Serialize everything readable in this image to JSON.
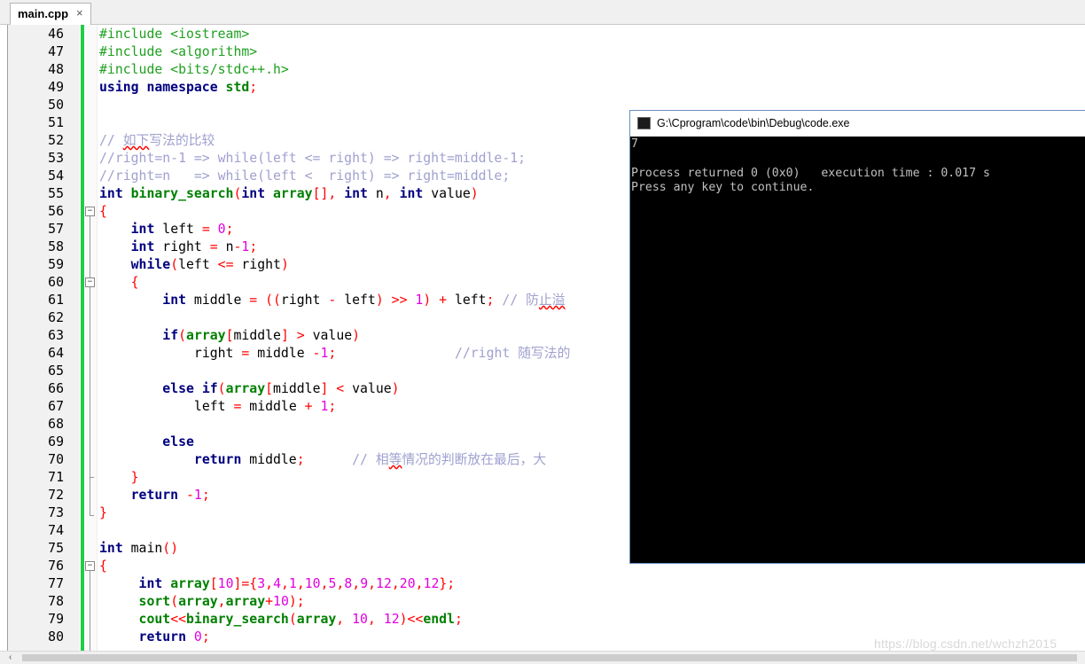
{
  "tab": {
    "label": "main.cpp",
    "close": "×"
  },
  "editor": {
    "lines": [
      {
        "n": "46",
        "tokens": [
          {
            "t": "#include <iostream>",
            "c": "pp"
          }
        ]
      },
      {
        "n": "47",
        "tokens": [
          {
            "t": "#include <algorithm>",
            "c": "pp"
          }
        ]
      },
      {
        "n": "48",
        "tokens": [
          {
            "t": "#include <bits/stdc++.h>",
            "c": "pp"
          }
        ]
      },
      {
        "n": "49",
        "tokens": [
          {
            "t": "using namespace ",
            "c": "kw"
          },
          {
            "t": "std",
            "c": "fn"
          },
          {
            "t": ";",
            "c": "op"
          }
        ]
      },
      {
        "n": "50",
        "tokens": []
      },
      {
        "n": "51",
        "tokens": []
      },
      {
        "n": "52",
        "tokens": [
          {
            "t": "// ",
            "c": "cm"
          },
          {
            "t": "如下",
            "c": "cm squig"
          },
          {
            "t": "写法的比较",
            "c": "cm"
          }
        ]
      },
      {
        "n": "53",
        "tokens": [
          {
            "t": "//right=n-1 => while(left <= right) => right=middle-1;",
            "c": "cm"
          }
        ]
      },
      {
        "n": "54",
        "tokens": [
          {
            "t": "//right=n   => while(left <  right) => right=middle;",
            "c": "cm"
          }
        ]
      },
      {
        "n": "55",
        "tokens": [
          {
            "t": "int ",
            "c": "kw"
          },
          {
            "t": "binary_search",
            "c": "fn"
          },
          {
            "t": "(",
            "c": "op"
          },
          {
            "t": "int ",
            "c": "kw"
          },
          {
            "t": "array",
            "c": "fn"
          },
          {
            "t": "[], ",
            "c": "op"
          },
          {
            "t": "int ",
            "c": "kw"
          },
          {
            "t": "n",
            "c": ""
          },
          {
            "t": ", ",
            "c": "op"
          },
          {
            "t": "int ",
            "c": "kw"
          },
          {
            "t": "value",
            "c": ""
          },
          {
            "t": ")",
            "c": "op"
          }
        ]
      },
      {
        "n": "56",
        "tokens": [
          {
            "t": "{",
            "c": "op"
          }
        ]
      },
      {
        "n": "57",
        "tokens": [
          {
            "t": "    ",
            "c": ""
          },
          {
            "t": "int ",
            "c": "kw"
          },
          {
            "t": "left ",
            "c": ""
          },
          {
            "t": "= ",
            "c": "op"
          },
          {
            "t": "0",
            "c": "num"
          },
          {
            "t": ";",
            "c": "op"
          }
        ]
      },
      {
        "n": "58",
        "tokens": [
          {
            "t": "    ",
            "c": ""
          },
          {
            "t": "int ",
            "c": "kw"
          },
          {
            "t": "right ",
            "c": ""
          },
          {
            "t": "= ",
            "c": "op"
          },
          {
            "t": "n",
            "c": ""
          },
          {
            "t": "-",
            "c": "op"
          },
          {
            "t": "1",
            "c": "num"
          },
          {
            "t": ";",
            "c": "op"
          }
        ]
      },
      {
        "n": "59",
        "tokens": [
          {
            "t": "    ",
            "c": ""
          },
          {
            "t": "while",
            "c": "kw"
          },
          {
            "t": "(",
            "c": "op"
          },
          {
            "t": "left ",
            "c": ""
          },
          {
            "t": "<= ",
            "c": "op"
          },
          {
            "t": "right",
            "c": ""
          },
          {
            "t": ")",
            "c": "op"
          }
        ]
      },
      {
        "n": "60",
        "tokens": [
          {
            "t": "    ",
            "c": ""
          },
          {
            "t": "{",
            "c": "op"
          }
        ]
      },
      {
        "n": "61",
        "tokens": [
          {
            "t": "        ",
            "c": ""
          },
          {
            "t": "int ",
            "c": "kw"
          },
          {
            "t": "middle ",
            "c": ""
          },
          {
            "t": "= ((",
            "c": "op"
          },
          {
            "t": "right ",
            "c": ""
          },
          {
            "t": "- ",
            "c": "op"
          },
          {
            "t": "left",
            "c": ""
          },
          {
            "t": ") >> ",
            "c": "op"
          },
          {
            "t": "1",
            "c": "num"
          },
          {
            "t": ") + ",
            "c": "op"
          },
          {
            "t": "left",
            "c": ""
          },
          {
            "t": "; ",
            "c": "op"
          },
          {
            "t": "// 防",
            "c": "cm"
          },
          {
            "t": "止溢",
            "c": "cm squig"
          }
        ]
      },
      {
        "n": "62",
        "tokens": []
      },
      {
        "n": "63",
        "tokens": [
          {
            "t": "        ",
            "c": ""
          },
          {
            "t": "if",
            "c": "kw"
          },
          {
            "t": "(",
            "c": "op"
          },
          {
            "t": "array",
            "c": "fn"
          },
          {
            "t": "[",
            "c": "op"
          },
          {
            "t": "middle",
            "c": ""
          },
          {
            "t": "] > ",
            "c": "op"
          },
          {
            "t": "value",
            "c": ""
          },
          {
            "t": ")",
            "c": "op"
          }
        ]
      },
      {
        "n": "64",
        "tokens": [
          {
            "t": "            ",
            "c": ""
          },
          {
            "t": "right ",
            "c": ""
          },
          {
            "t": "= ",
            "c": "op"
          },
          {
            "t": "middle ",
            "c": ""
          },
          {
            "t": "-",
            "c": "op"
          },
          {
            "t": "1",
            "c": "num"
          },
          {
            "t": ";",
            "c": "op"
          },
          {
            "t": "               //right 随写法的",
            "c": "cm"
          }
        ]
      },
      {
        "n": "65",
        "tokens": []
      },
      {
        "n": "66",
        "tokens": [
          {
            "t": "        ",
            "c": ""
          },
          {
            "t": "else if",
            "c": "kw"
          },
          {
            "t": "(",
            "c": "op"
          },
          {
            "t": "array",
            "c": "fn"
          },
          {
            "t": "[",
            "c": "op"
          },
          {
            "t": "middle",
            "c": ""
          },
          {
            "t": "] < ",
            "c": "op"
          },
          {
            "t": "value",
            "c": ""
          },
          {
            "t": ")",
            "c": "op"
          }
        ]
      },
      {
        "n": "67",
        "tokens": [
          {
            "t": "            ",
            "c": ""
          },
          {
            "t": "left ",
            "c": ""
          },
          {
            "t": "= ",
            "c": "op"
          },
          {
            "t": "middle ",
            "c": ""
          },
          {
            "t": "+ ",
            "c": "op"
          },
          {
            "t": "1",
            "c": "num"
          },
          {
            "t": ";",
            "c": "op"
          }
        ]
      },
      {
        "n": "68",
        "tokens": []
      },
      {
        "n": "69",
        "tokens": [
          {
            "t": "        ",
            "c": ""
          },
          {
            "t": "else",
            "c": "kw"
          }
        ]
      },
      {
        "n": "70",
        "tokens": [
          {
            "t": "            ",
            "c": ""
          },
          {
            "t": "return ",
            "c": "kw"
          },
          {
            "t": "middle",
            "c": ""
          },
          {
            "t": ";",
            "c": "op"
          },
          {
            "t": "      // 相",
            "c": "cm"
          },
          {
            "t": "等",
            "c": "cm squig"
          },
          {
            "t": "情况的判断放在最后，大",
            "c": "cm"
          }
        ]
      },
      {
        "n": "71",
        "tokens": [
          {
            "t": "    ",
            "c": ""
          },
          {
            "t": "}",
            "c": "op"
          }
        ]
      },
      {
        "n": "72",
        "tokens": [
          {
            "t": "    ",
            "c": ""
          },
          {
            "t": "return ",
            "c": "kw"
          },
          {
            "t": "-",
            "c": "op"
          },
          {
            "t": "1",
            "c": "num"
          },
          {
            "t": ";",
            "c": "op"
          }
        ]
      },
      {
        "n": "73",
        "tokens": [
          {
            "t": "}",
            "c": "op"
          }
        ]
      },
      {
        "n": "74",
        "tokens": []
      },
      {
        "n": "75",
        "tokens": [
          {
            "t": "int ",
            "c": "kw"
          },
          {
            "t": "main",
            "c": ""
          },
          {
            "t": "()",
            "c": "op"
          }
        ]
      },
      {
        "n": "76",
        "tokens": [
          {
            "t": "{",
            "c": "op"
          }
        ]
      },
      {
        "n": "77",
        "tokens": [
          {
            "t": "     ",
            "c": ""
          },
          {
            "t": "int ",
            "c": "kw"
          },
          {
            "t": "array",
            "c": "fn"
          },
          {
            "t": "[",
            "c": "op"
          },
          {
            "t": "10",
            "c": "num"
          },
          {
            "t": "]={",
            "c": "op"
          },
          {
            "t": "3",
            "c": "num"
          },
          {
            "t": ",",
            "c": "op"
          },
          {
            "t": "4",
            "c": "num"
          },
          {
            "t": ",",
            "c": "op"
          },
          {
            "t": "1",
            "c": "num"
          },
          {
            "t": ",",
            "c": "op"
          },
          {
            "t": "10",
            "c": "num"
          },
          {
            "t": ",",
            "c": "op"
          },
          {
            "t": "5",
            "c": "num"
          },
          {
            "t": ",",
            "c": "op"
          },
          {
            "t": "8",
            "c": "num"
          },
          {
            "t": ",",
            "c": "op"
          },
          {
            "t": "9",
            "c": "num"
          },
          {
            "t": ",",
            "c": "op"
          },
          {
            "t": "12",
            "c": "num"
          },
          {
            "t": ",",
            "c": "op"
          },
          {
            "t": "20",
            "c": "num"
          },
          {
            "t": ",",
            "c": "op"
          },
          {
            "t": "12",
            "c": "num"
          },
          {
            "t": "};",
            "c": "op"
          }
        ]
      },
      {
        "n": "78",
        "tokens": [
          {
            "t": "     ",
            "c": ""
          },
          {
            "t": "sort",
            "c": "fn"
          },
          {
            "t": "(",
            "c": "op"
          },
          {
            "t": "array",
            "c": "fn"
          },
          {
            "t": ",",
            "c": "op"
          },
          {
            "t": "array",
            "c": "fn"
          },
          {
            "t": "+",
            "c": "op"
          },
          {
            "t": "10",
            "c": "num"
          },
          {
            "t": ");",
            "c": "op"
          }
        ]
      },
      {
        "n": "79",
        "tokens": [
          {
            "t": "     ",
            "c": ""
          },
          {
            "t": "cout",
            "c": "fn"
          },
          {
            "t": "<<",
            "c": "op"
          },
          {
            "t": "binary_search",
            "c": "fn"
          },
          {
            "t": "(",
            "c": "op"
          },
          {
            "t": "array",
            "c": "fn"
          },
          {
            "t": ", ",
            "c": "op"
          },
          {
            "t": "10",
            "c": "num"
          },
          {
            "t": ", ",
            "c": "op"
          },
          {
            "t": "12",
            "c": "num"
          },
          {
            "t": ")<<",
            "c": "op"
          },
          {
            "t": "endl",
            "c": "fn"
          },
          {
            "t": ";",
            "c": "op"
          }
        ]
      },
      {
        "n": "80",
        "tokens": [
          {
            "t": "     ",
            "c": ""
          },
          {
            "t": "return ",
            "c": "kw"
          },
          {
            "t": "0",
            "c": "num"
          },
          {
            "t": ";",
            "c": "op"
          }
        ]
      }
    ]
  },
  "console": {
    "title": "G:\\Cprogram\\code\\bin\\Debug\\code.exe",
    "lines": [
      "7",
      "",
      "Process returned 0 (0x0)   execution time : 0.017 s",
      "Press any key to continue."
    ]
  },
  "scrollbar": {
    "left_arrow": "‹"
  },
  "watermark": "https://blog.csdn.net/wchzh2015"
}
